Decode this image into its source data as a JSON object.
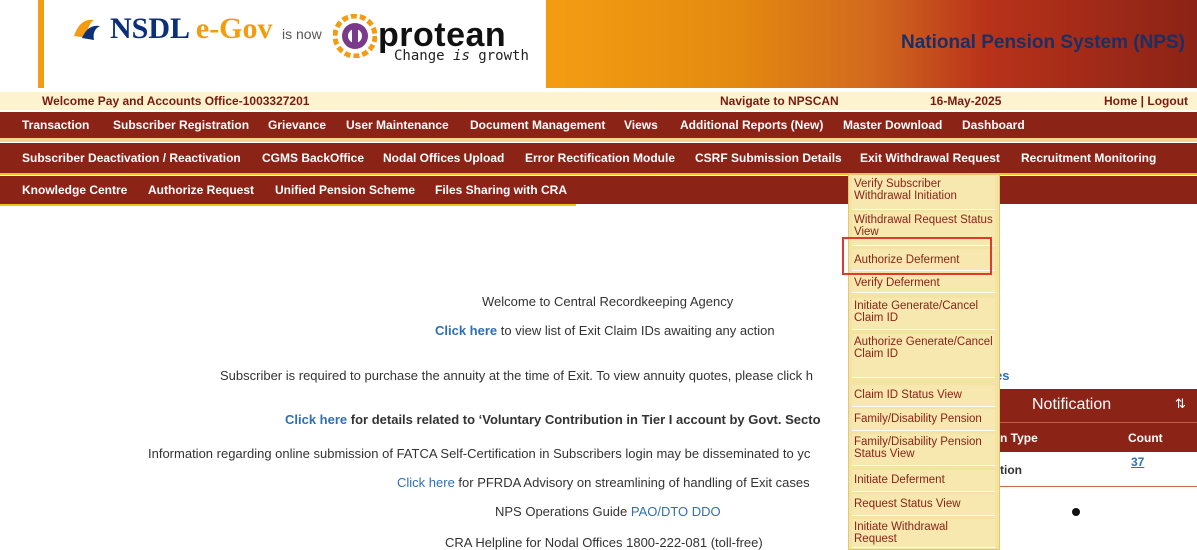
{
  "header": {
    "nsdl_logo_prefix": "NSDL",
    "nsdl_logo_suffix": "e-Gov",
    "is_now": "is now",
    "protean_name": "protean",
    "protean_tagline_a": "Change ",
    "protean_tagline_b": "is",
    "protean_tagline_c": " growth",
    "system_title": "National Pension System (NPS)"
  },
  "welcome_bar": {
    "welcome": "Welcome Pay and Accounts Office-1003327201",
    "navigate": "Navigate to NPSCAN",
    "date": "16-May-2025",
    "home": "Home",
    "separator": " | ",
    "logout": "Logout"
  },
  "menu_row1": [
    "Transaction",
    "Subscriber Registration",
    "Grievance",
    "User Maintenance",
    "Document Management",
    "Views",
    "Additional Reports (New)",
    "Master Download",
    "Dashboard"
  ],
  "menu_row2": [
    "Subscriber Deactivation / Reactivation",
    "CGMS BackOffice",
    "Nodal Offices Upload",
    "Error Rectification Module",
    "CSRF Submission Details",
    "Exit Withdrawal Request",
    "Recruitment Monitoring"
  ],
  "menu_row3": [
    "Knowledge Centre",
    "Authorize Request",
    "Unified Pension Scheme",
    "Files Sharing with CRA"
  ],
  "dropdown": [
    "Verify Subscriber Withdrawal Initiation",
    "Withdrawal Request Status View",
    "Authorize Deferment",
    "Verify Deferment",
    "Initiate Generate/Cancel Claim ID",
    "Authorize Generate/Cancel Claim ID",
    "Claim ID Status View",
    "Family/Disability Pension",
    "Family/Disability Pension Status View",
    "Initiate Deferment",
    "Request Status View",
    "Initiate Withdrawal Request"
  ],
  "content": {
    "welcome": "Welcome to Central Recordkeeping Agency",
    "click_here": "Click here",
    "exit_claims": " to view list of Exit Claim IDs awaiting any action",
    "annuity": "Subscriber is required to purchase the annuity at the time of Exit. To view annuity quotes, please click h",
    "annuity_tail": "es",
    "voluntary": " for details related to ‘Voluntary Contribution in Tier I account by Govt. Secto",
    "fatca": "Information regarding online submission of FATCA Self-Certification in Subscribers login may be disseminated to yc",
    "pfrda": " for PFRDA Advisory on streamlining of handling of Exit cases",
    "ops_guide": "NPS Operations Guide ",
    "ops_links": "PAO/DTO DDO",
    "helpline": "CRA Helpline for Nodal Offices 1800-222-081 (toll-free)"
  },
  "notification": {
    "title": "Notification",
    "sort_icon": "sort-icon",
    "col_type": "n Type",
    "col_count": "Count",
    "row_type": "tion",
    "row_count": "37"
  },
  "colors": {
    "menu_bg": "#8b2316",
    "dropdown_bg": "#f5e3a3",
    "highlight": "#e03a2a",
    "link": "#2f6fb5"
  }
}
